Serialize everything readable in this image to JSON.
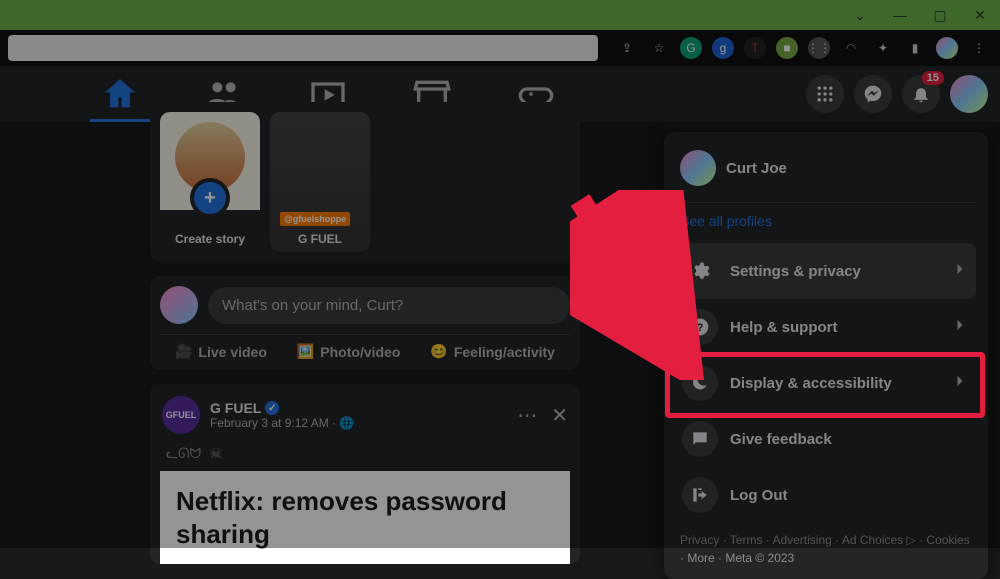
{
  "browser": {
    "window_buttons": {
      "dropdown": "⌄",
      "min": "—",
      "max": "▢",
      "close": "✕"
    },
    "ext_icons": [
      "share-icon",
      "star-icon",
      "g1",
      "g2",
      "t",
      "m",
      "mm",
      "arc",
      "puzzle",
      "book",
      "avatar",
      "more"
    ]
  },
  "nav": {
    "tabs": [
      "home",
      "friends",
      "video",
      "marketplace",
      "gaming"
    ]
  },
  "topright": {
    "notifications_badge": "15"
  },
  "stories": {
    "create_label": "Create story",
    "story2_label": "G FUEL",
    "story2_tag": "@gfuelshoppe"
  },
  "composer": {
    "placeholder": "What's on your mind, Curt?",
    "live": "Live video",
    "photo": "Photo/video",
    "feeling": "Feeling/activity"
  },
  "post": {
    "author": "G FUEL",
    "timestamp": "February 3 at 9:12 AM",
    "globe": "·",
    "doodle": "ᓚᘏᗢ  ☠",
    "headline": "Netflix: removes password sharing"
  },
  "menu": {
    "profile_name": "Curt Joe",
    "see_all": "See all profiles",
    "items": [
      {
        "label": "Settings & privacy",
        "icon": "gear",
        "chev": true
      },
      {
        "label": "Help & support",
        "icon": "help",
        "chev": true
      },
      {
        "label": "Display & accessibility",
        "icon": "moon",
        "chev": true
      },
      {
        "label": "Give feedback",
        "icon": "feedback",
        "chev": false
      },
      {
        "label": "Log Out",
        "icon": "logout",
        "chev": false
      }
    ],
    "footer": "Privacy · Terms · Advertising · Ad Choices ▷ · Cookies ·  More · Meta © 2023"
  }
}
